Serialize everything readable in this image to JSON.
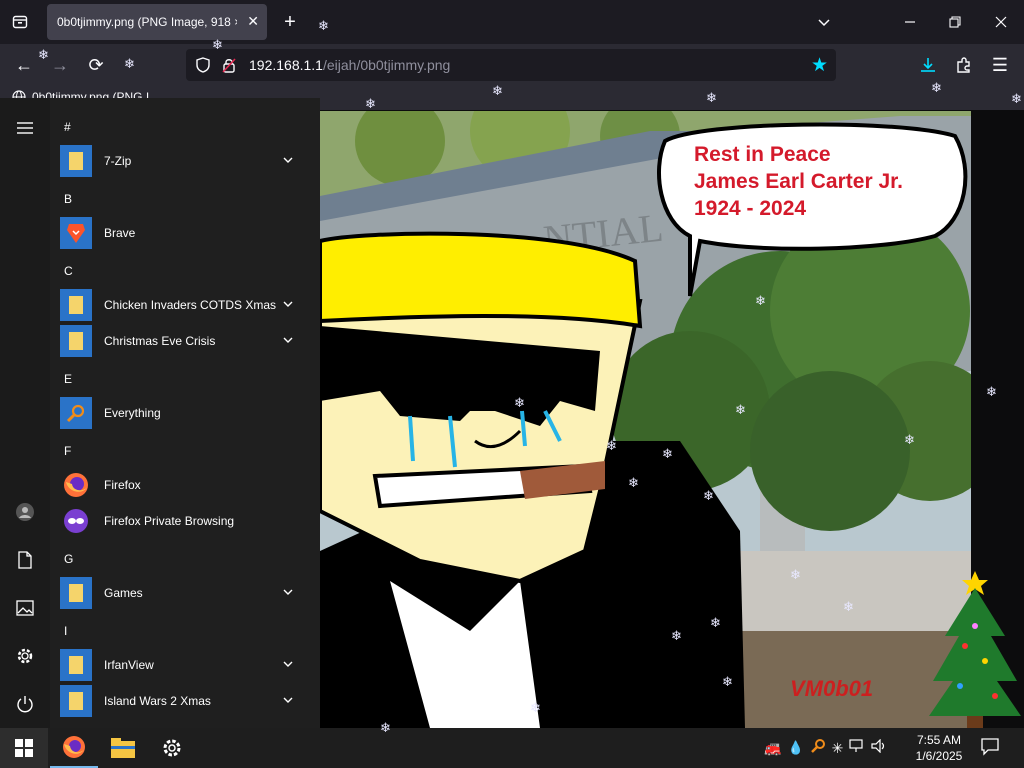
{
  "browser": {
    "tab_title": "0b0tjimmy.png (PNG Image, 918 ×",
    "url_host": "192.168.1.1",
    "url_path": "/eijah/0b0tjimmy.png",
    "bookmark_label": "0b0tjimmy.png (PNG I",
    "accent": "#00ddff"
  },
  "image": {
    "speech_line1": "Rest in Peace",
    "speech_line2": "James Earl Carter Jr.",
    "speech_line3": "1924 - 2024",
    "sign_text": "NTIAL",
    "watermark": "VM0b01"
  },
  "start_menu": {
    "sections": [
      {
        "letter": "#",
        "apps": [
          {
            "label": "7-Zip",
            "icon": "folder-icon",
            "expand": true
          }
        ]
      },
      {
        "letter": "B",
        "apps": [
          {
            "label": "Brave",
            "icon": "brave-icon",
            "expand": false
          }
        ]
      },
      {
        "letter": "C",
        "apps": [
          {
            "label": "Chicken Invaders COTDS Xmas",
            "icon": "folder-icon",
            "expand": true
          },
          {
            "label": "Christmas Eve Crisis",
            "icon": "folder-icon",
            "expand": true
          }
        ]
      },
      {
        "letter": "E",
        "apps": [
          {
            "label": "Everything",
            "icon": "search-icon",
            "expand": false
          }
        ]
      },
      {
        "letter": "F",
        "apps": [
          {
            "label": "Firefox",
            "icon": "firefox-icon",
            "expand": false
          },
          {
            "label": "Firefox Private Browsing",
            "icon": "private-browsing-icon",
            "expand": false
          }
        ]
      },
      {
        "letter": "G",
        "apps": [
          {
            "label": "Games",
            "icon": "folder-icon",
            "expand": true
          }
        ]
      },
      {
        "letter": "I",
        "apps": [
          {
            "label": "IrfanView",
            "icon": "folder-icon",
            "expand": true
          },
          {
            "label": "Island Wars 2 Xmas",
            "icon": "folder-icon",
            "expand": true
          }
        ]
      }
    ]
  },
  "taskbar": {
    "time": "7:55 AM",
    "date": "1/6/2025"
  }
}
